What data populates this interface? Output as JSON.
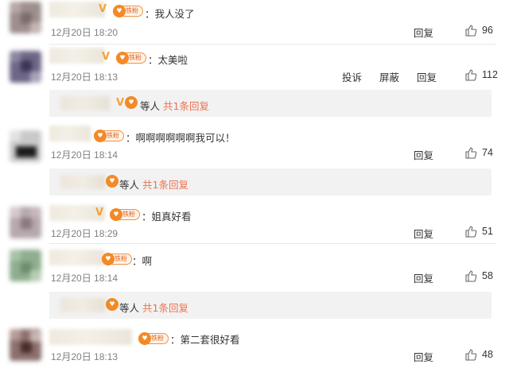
{
  "comments": [
    {
      "text": "：我人没了",
      "time": "12月20日 18:20",
      "actions": [
        "回复"
      ],
      "likes": "96",
      "badge": "铁粉"
    },
    {
      "text": "：太美啦",
      "time": "12月20日 18:13",
      "actions": [
        "投诉",
        "屏蔽",
        "回复"
      ],
      "likes": "112",
      "badge": "铁粉",
      "reply": {
        "who": "等人",
        "link": "共1条回复"
      }
    },
    {
      "text": "：啊啊啊啊啊啊我可以！",
      "time": "12月20日 18:14",
      "actions": [
        "回复"
      ],
      "likes": "74",
      "badge": "铁粉",
      "reply": {
        "who": "等人",
        "link": "共1条回复"
      }
    },
    {
      "text": "：姐真好看",
      "time": "12月20日 18:29",
      "actions": [
        "回复"
      ],
      "likes": "51",
      "badge": "铁粉"
    },
    {
      "text": "：啊",
      "time": "12月20日 18:14",
      "actions": [
        "回复"
      ],
      "likes": "58",
      "badge": "铁粉",
      "reply": {
        "who": "等人",
        "link": "共1条回复"
      }
    },
    {
      "text": "：第二套很好看",
      "time": "12月20日 18:13",
      "actions": [
        "回复"
      ],
      "likes": "48",
      "badge": "铁粉"
    }
  ],
  "colors": {
    "link": "#eb7350",
    "badge": "#f38a26",
    "time": "#808080"
  },
  "icons": {
    "like": "thumbs-up-icon",
    "verified": "v-verified-icon",
    "fan": "fan-heart-icon"
  }
}
